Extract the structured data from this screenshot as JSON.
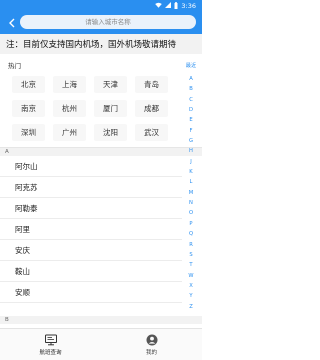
{
  "status_bar": {
    "time": "3:36",
    "icons": [
      "wifi-icon",
      "signal-icon",
      "battery-icon"
    ]
  },
  "header": {
    "back_icon": "chevron-left-icon",
    "search_placeholder": "请输入城市名称"
  },
  "notice": {
    "text": "注：目前仅支持国内机场，国外机场敬请期待"
  },
  "hot": {
    "title": "热门",
    "cities": [
      "北京",
      "上海",
      "天津",
      "青岛",
      "南京",
      "杭州",
      "厦门",
      "成都",
      "深圳",
      "广州",
      "沈阳",
      "武汉"
    ]
  },
  "sections": [
    {
      "letter": "A",
      "cities": [
        "阿尔山",
        "阿克苏",
        "阿勒泰",
        "阿里",
        "安庆",
        "鞍山",
        "安顺"
      ]
    },
    {
      "letter": "B",
      "cities": []
    }
  ],
  "index": [
    "最近",
    "A",
    "B",
    "C",
    "D",
    "E",
    "F",
    "G",
    "H",
    "J",
    "K",
    "L",
    "M",
    "N",
    "O",
    "P",
    "Q",
    "R",
    "S",
    "T",
    "W",
    "X",
    "Y",
    "Z"
  ],
  "tabs": [
    {
      "label": "航班查询",
      "icon": "flight-query-icon",
      "active": true
    },
    {
      "label": "我的",
      "icon": "profile-icon",
      "active": false
    }
  ],
  "colors": {
    "brand": "#2a8ff0",
    "notice_bg": "#f2f2f2",
    "index_text": "#2a8ff0"
  }
}
